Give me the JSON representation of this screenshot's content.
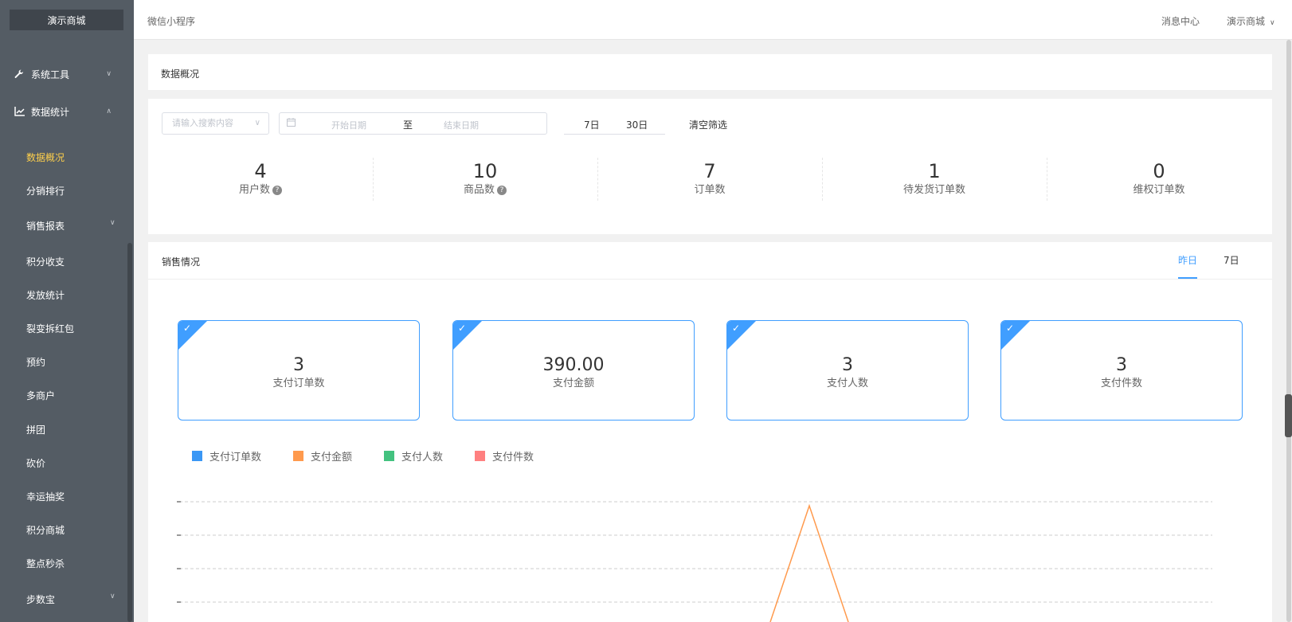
{
  "sidebar": {
    "brand": "演示商城",
    "items": [
      {
        "label": "系统工具",
        "icon": "wrench-icon"
      },
      {
        "label": "数据统计",
        "icon": "line-chart-icon"
      }
    ],
    "subitems": [
      {
        "label": "数据概况",
        "active": true
      },
      {
        "label": "分销排行"
      },
      {
        "label": "销售报表",
        "has_children": true
      },
      {
        "label": "积分收支"
      },
      {
        "label": "发放统计"
      },
      {
        "label": "裂变拆红包"
      },
      {
        "label": "预约"
      },
      {
        "label": "多商户"
      },
      {
        "label": "拼团"
      },
      {
        "label": "砍价"
      },
      {
        "label": "幸运抽奖"
      },
      {
        "label": "积分商城"
      },
      {
        "label": "整点秒杀"
      },
      {
        "label": "步数宝",
        "has_children": true
      }
    ]
  },
  "topbar": {
    "breadcrumb": "微信小程序",
    "message_center": "消息中心",
    "user_menu": "演示商城"
  },
  "overview": {
    "title": "数据概况",
    "search_placeholder": "请输入搜索内容",
    "start_placeholder": "开始日期",
    "range_separator": "至",
    "end_placeholder": "结束日期",
    "quick_ranges": [
      "7日",
      "30日"
    ],
    "clear_filter": "清空筛选",
    "stats": [
      {
        "value": "4",
        "label": "用户数",
        "help": true
      },
      {
        "value": "10",
        "label": "商品数",
        "help": true
      },
      {
        "value": "7",
        "label": "订单数"
      },
      {
        "value": "1",
        "label": "待发货订单数"
      },
      {
        "value": "0",
        "label": "维权订单数"
      }
    ]
  },
  "sales": {
    "title": "销售情况",
    "tabs": [
      "昨日",
      "7日"
    ],
    "active_tab": "昨日",
    "kpis": [
      {
        "value": "3",
        "label": "支付订单数"
      },
      {
        "value": "390.00",
        "label": "支付金额"
      },
      {
        "value": "3",
        "label": "支付人数"
      },
      {
        "value": "3",
        "label": "支付件数"
      }
    ]
  },
  "colors": {
    "accent": "#409eff",
    "sidebar_bg": "#545c64",
    "sidebar_active": "#ffd04b"
  },
  "chart_data": {
    "type": "line",
    "legend_position": "top-left",
    "grid": true,
    "series": [
      {
        "name": "支付订单数",
        "color": "#3a97f5"
      },
      {
        "name": "支付金额",
        "color": "#ff9a4d"
      },
      {
        "name": "支付人数",
        "color": "#43c27f"
      },
      {
        "name": "支付件数",
        "color": "#ff8080"
      }
    ]
  }
}
